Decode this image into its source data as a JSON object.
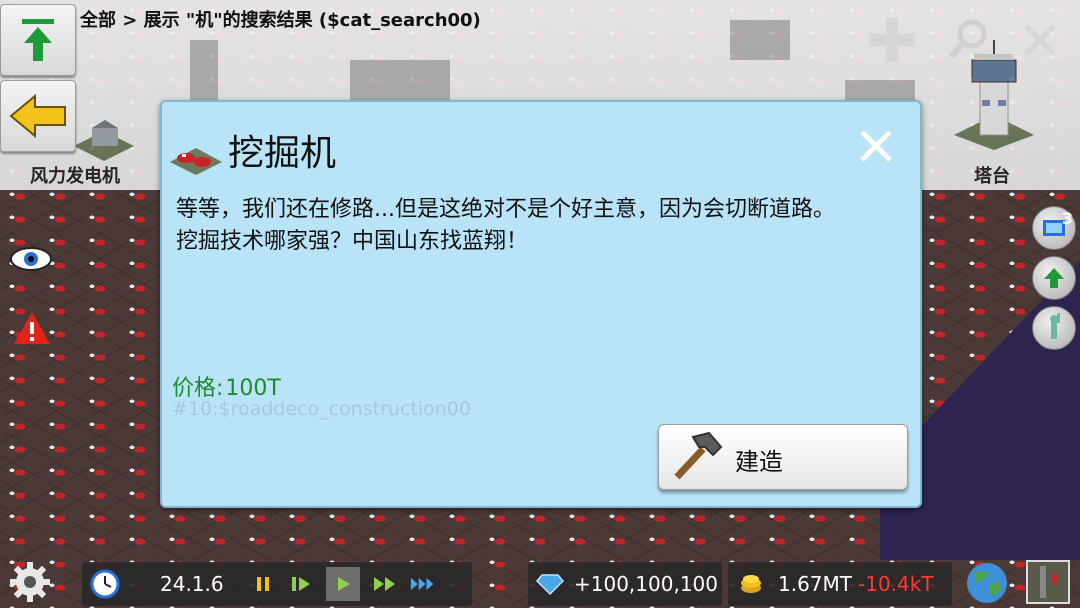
{
  "breadcrumb": "全部 > 展示 \"机\"的搜索结果 ($cat_search00)",
  "categories": {
    "left_label": "风力发电机",
    "right_label": "塔台"
  },
  "dialog": {
    "title": "挖掘机",
    "description_lines": [
      "等等，我们还在修路...但是这绝对不是个好主意，因为会切断道路。",
      "挖掘技术哪家强？中国山东找蓝翔！"
    ],
    "price_label": "价格:",
    "price_value": "100T",
    "identifier": "#10:$roaddeco_construction00",
    "build_label": "建造"
  },
  "right_panel": {
    "notification_count": "3"
  },
  "bottom_bar": {
    "date": "24.1.6",
    "diamonds": "+100,100,100",
    "money": "1.67MT",
    "money_delta": "-10.4kT"
  },
  "colors": {
    "dialog_bg": "#b9e3f7",
    "price_green": "#1f8a2c",
    "delta_red": "#ff3b30",
    "speed_green": "#8fd14f",
    "fast_blue": "#4aa8e8"
  },
  "icons": {
    "upload": "green-up-arrow-icon",
    "back": "yellow-left-arrow-icon",
    "search": "search-icon",
    "close": "close-icon",
    "add": "plus-icon",
    "settings": "gear-icon",
    "clock": "clock-icon",
    "diamond": "diamond-icon",
    "coins": "coins-icon",
    "globe": "globe-icon",
    "build": "hammer-icon"
  }
}
